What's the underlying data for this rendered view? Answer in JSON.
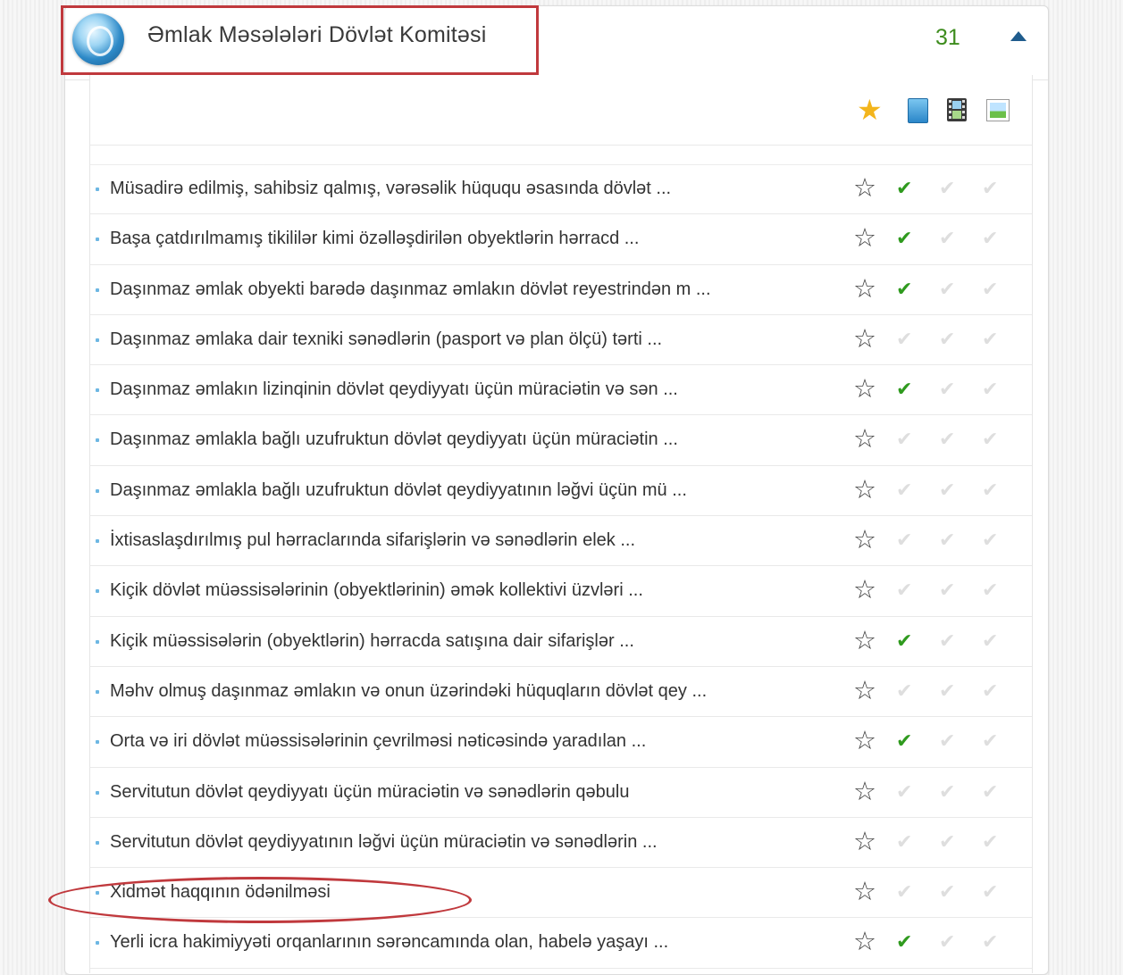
{
  "header": {
    "title": "Əmlak Məsələləri Dövlət Komitəsi",
    "count": "31"
  },
  "toolbar": {
    "icons": [
      "star-filled-icon",
      "document-icon",
      "video-icon",
      "image-icon"
    ]
  },
  "colors": {
    "accent_green": "#3d8c1d",
    "check_green": "#2f9a1e",
    "highlight_red": "#c0393d",
    "collapse_blue": "#1f5c8d"
  },
  "symbols": {
    "star_outline": "☆",
    "star_filled": "★",
    "check": "✔"
  },
  "services": [
    {
      "text": "Müsadirə edilmiş, sahibsiz qalmış, vərəsəlik hüququ əsasında dövlət ...",
      "checks": [
        true,
        false,
        false
      ]
    },
    {
      "text": "Başa çatdırılmamış tikililər kimi özəlləşdirilən obyektlərin hərracd ...",
      "checks": [
        true,
        false,
        false
      ]
    },
    {
      "text": "Daşınmaz əmlak obyekti barədə daşınmaz əmlakın dövlət reyestrindən m ...",
      "checks": [
        true,
        false,
        false
      ]
    },
    {
      "text": "Daşınmaz əmlaka dair texniki sənədlərin (pasport və plan ölçü) tərti ...",
      "checks": [
        false,
        false,
        false
      ]
    },
    {
      "text": "Daşınmaz əmlakın lizinqinin dövlət qeydiyyatı üçün müraciətin və sən ...",
      "checks": [
        true,
        false,
        false
      ]
    },
    {
      "text": "Daşınmaz əmlakla bağlı uzufruktun dövlət qeydiyyatı üçün müraciətin ...",
      "checks": [
        false,
        false,
        false
      ]
    },
    {
      "text": "Daşınmaz əmlakla bağlı uzufruktun dövlət qeydiyyatının ləğvi üçün mü ...",
      "checks": [
        false,
        false,
        false
      ]
    },
    {
      "text": "İxtisaslaşdırılmış pul hərraclarında sifarişlərin və sənədlərin elek ...",
      "checks": [
        false,
        false,
        false
      ]
    },
    {
      "text": "Kiçik dövlət müəssisələrinin (obyektlərinin) əmək kollektivi üzvləri ...",
      "checks": [
        false,
        false,
        false
      ]
    },
    {
      "text": "Kiçik müəssisələrin (obyektlərin) hərracda satışına dair sifarişlər ...",
      "checks": [
        true,
        false,
        false
      ]
    },
    {
      "text": "Məhv olmuş daşınmaz əmlakın və onun üzərindəki hüquqların dövlət qey ...",
      "checks": [
        false,
        false,
        false
      ]
    },
    {
      "text": "Orta və iri dövlət müəssisələrinin çevrilməsi nəticəsində yaradılan ...",
      "checks": [
        true,
        false,
        false
      ]
    },
    {
      "text": "Servitutun dövlət qeydiyyatı üçün müraciətin və sənədlərin qəbulu",
      "checks": [
        false,
        false,
        false
      ]
    },
    {
      "text": "Servitutun dövlət qeydiyyatının ləğvi üçün müraciətin və sənədlərin ...",
      "checks": [
        false,
        false,
        false
      ]
    },
    {
      "text": "Xidmət haqqının ödənilməsi",
      "checks": [
        false,
        false,
        false
      ]
    },
    {
      "text": "Yerli icra hakimiyyəti orqanlarının sərəncamında olan, habelə yaşayı ...",
      "checks": [
        true,
        false,
        false
      ]
    }
  ]
}
